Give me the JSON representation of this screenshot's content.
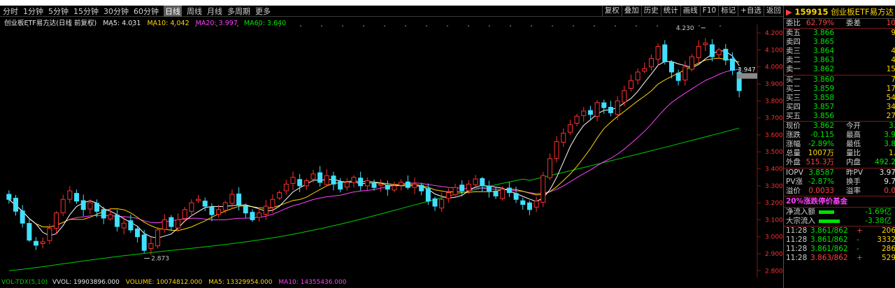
{
  "app": {
    "window_title": ""
  },
  "toolbar": {
    "periods": [
      "分时",
      "1分钟",
      "5分钟",
      "15分钟",
      "30分钟",
      "60分钟",
      "日线",
      "周线",
      "月线",
      "多周期",
      "更多"
    ],
    "active_period": "日线",
    "actions": [
      "复权",
      "叠加",
      "历史",
      "统计",
      "画线",
      "F10",
      "标记",
      "+自选",
      "返回"
    ]
  },
  "chart_header": {
    "title": "创业板ETF易方达(日线 前复权)",
    "ma5": "MA5: 4.031",
    "ma10": "MA10: 4.042",
    "ma20": "MA20: 3.997",
    "ma60": "MA60: 3.640"
  },
  "price_axis": {
    "ticks": [
      "4.200",
      "4.100",
      "4.000",
      "3.900",
      "3.800",
      "3.700",
      "3.600",
      "3.500",
      "3.400",
      "3.300",
      "3.200",
      "3.100",
      "3.000",
      "2.900",
      "2.800"
    ]
  },
  "annotations": {
    "high": "4.230",
    "low": "2.873",
    "last_marker": "3.947"
  },
  "volume_header": {
    "name": "VOL-TDX(5,10)",
    "vvol": "VVOL: 19903896.000",
    "volume": "VOLUME: 10074812.000",
    "ma5": "MA5: 13329954.000",
    "ma10": "MA10: 14355436.000"
  },
  "colors": {
    "up": "#ff3030",
    "down": "#40e0ff",
    "ma5": "#ffffff",
    "ma10": "#ffd700",
    "ma20": "#ff40ff",
    "ma60": "#00d000",
    "accent": "#ffd700"
  },
  "chart_data": {
    "type": "candlestick",
    "ylim": [
      2.76,
      4.25
    ],
    "y_ticks": [
      2.8,
      2.9,
      3.0,
      3.1,
      3.2,
      3.3,
      3.4,
      3.5,
      3.6,
      3.7,
      3.8,
      3.9,
      4.0,
      4.1,
      4.2
    ],
    "closes": [
      3.22,
      3.15,
      3.08,
      2.98,
      2.95,
      2.97,
      3.05,
      3.14,
      3.22,
      3.27,
      3.21,
      3.16,
      3.2,
      3.15,
      3.11,
      3.13,
      3.06,
      3.08,
      3.04,
      3.0,
      2.92,
      2.96,
      3.04,
      3.1,
      3.06,
      3.1,
      3.16,
      3.2,
      3.22,
      3.18,
      3.13,
      3.16,
      3.2,
      3.25,
      3.19,
      3.14,
      3.1,
      3.14,
      3.18,
      3.22,
      3.26,
      3.31,
      3.35,
      3.3,
      3.33,
      3.37,
      3.32,
      3.36,
      3.31,
      3.28,
      3.32,
      3.35,
      3.3,
      3.33,
      3.29,
      3.31,
      3.28,
      3.3,
      3.32,
      3.29,
      3.31,
      3.27,
      3.21,
      3.18,
      3.22,
      3.26,
      3.29,
      3.27,
      3.31,
      3.34,
      3.3,
      3.27,
      3.24,
      3.28,
      3.26,
      3.22,
      3.19,
      3.16,
      3.21,
      3.36,
      3.46,
      3.56,
      3.61,
      3.66,
      3.71,
      3.74,
      3.72,
      3.79,
      3.76,
      3.73,
      3.8,
      3.86,
      3.92,
      3.97,
      3.99,
      4.05,
      4.12,
      4.03,
      3.97,
      3.92,
      4.0,
      4.06,
      4.12,
      4.14,
      4.06,
      4.1,
      4.04,
      3.98,
      3.86
    ],
    "high": 4.23,
    "low": 2.873,
    "ma_last": {
      "MA5": 4.031,
      "MA10": 4.042,
      "MA20": 3.997,
      "MA60": 3.64
    }
  },
  "sidebar": {
    "code": "159915",
    "name": "创业板ETF易方达",
    "weibi_label": "委比",
    "weibi": "62.79%",
    "weicha_label": "委差",
    "weicha": "10",
    "sells": [
      {
        "label": "卖五",
        "price": "3.866",
        "vol": "9"
      },
      {
        "label": "卖四",
        "price": "3.865",
        "vol": ""
      },
      {
        "label": "卖三",
        "price": "3.864",
        "vol": "4"
      },
      {
        "label": "卖二",
        "price": "3.863",
        "vol": "4"
      },
      {
        "label": "卖一",
        "price": "3.862",
        "vol": "15"
      }
    ],
    "buys": [
      {
        "label": "买一",
        "price": "3.860",
        "vol": "7"
      },
      {
        "label": "买二",
        "price": "3.859",
        "vol": "17"
      },
      {
        "label": "买三",
        "price": "3.858",
        "vol": "54"
      },
      {
        "label": "买四",
        "price": "3.857",
        "vol": "34"
      },
      {
        "label": "买五",
        "price": "3.856",
        "vol": "27"
      }
    ],
    "quote": [
      {
        "l": "现价",
        "v": "3.862",
        "l2": "今开",
        "v2": "3."
      },
      {
        "l": "涨跌",
        "v": "-0.115",
        "l2": "最高",
        "v2": "3.9"
      },
      {
        "l": "涨幅",
        "v": "-2.89%",
        "l2": "最低",
        "v2": "3.8"
      },
      {
        "l": "总量",
        "v": "1007万",
        "l2": "量比",
        "v2": "1."
      },
      {
        "l": "外盘",
        "v": "515.3万",
        "l2": "内盘",
        "v2": "492.2"
      }
    ],
    "iopv": [
      {
        "l": "IOPV",
        "v": "3.8587",
        "l2": "昨PV",
        "v2": "3.97"
      },
      {
        "l": "PV涨",
        "v": "-2.87%",
        "l2": "换手",
        "v2": "9.7"
      },
      {
        "l": "溢价",
        "v": "0.0033",
        "l2": "溢率",
        "v2": "0.0"
      }
    ],
    "fund_type": "20%涨跌停价基金",
    "flows": [
      {
        "l": "净流入额",
        "v": "-1.69亿"
      },
      {
        "l": "大宗流入",
        "v": "-3.38亿"
      }
    ],
    "ticks": [
      {
        "t": "11:28",
        "p": "3.861/862",
        "d": "+",
        "q": "206"
      },
      {
        "t": "11:28",
        "p": "3.861/862",
        "d": "-",
        "q": "3332"
      },
      {
        "t": "11:28",
        "p": "3.861/862",
        "d": "-",
        "q": "286"
      },
      {
        "t": "11:28",
        "p": "3.863/862",
        "d": "+",
        "q": "529"
      }
    ]
  }
}
